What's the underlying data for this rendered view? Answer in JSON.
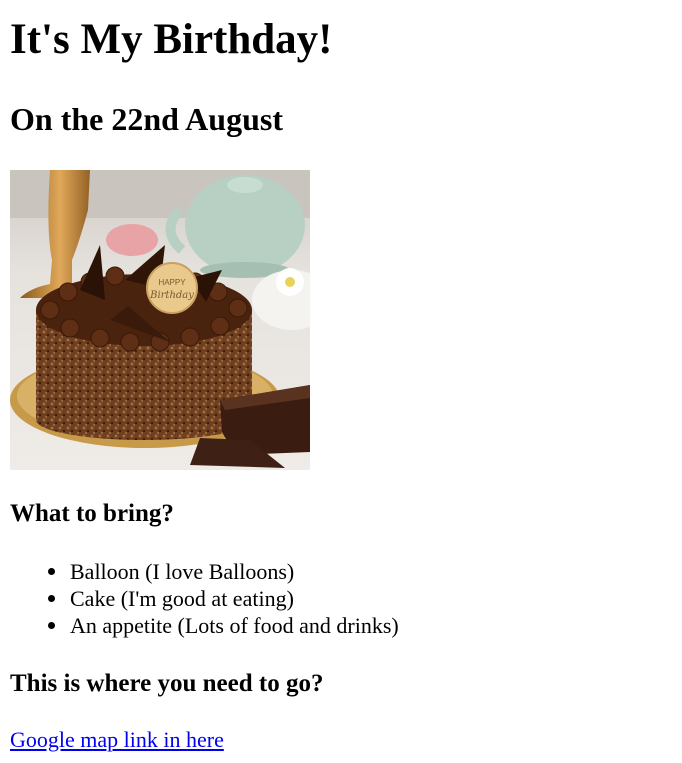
{
  "page": {
    "title": "It's My Birthday!",
    "subtitle": "On the 22nd August"
  },
  "photo": {
    "topper_line1": "HAPPY",
    "topper_line2": "Birthday"
  },
  "bring": {
    "heading": "What to bring?",
    "items": [
      "Balloon (I love Balloons)",
      "Cake (I'm good at eating)",
      "An appetite (Lots of food and drinks)"
    ]
  },
  "location": {
    "heading": "This is where you need to go?",
    "link_text": "Google map link in here"
  }
}
